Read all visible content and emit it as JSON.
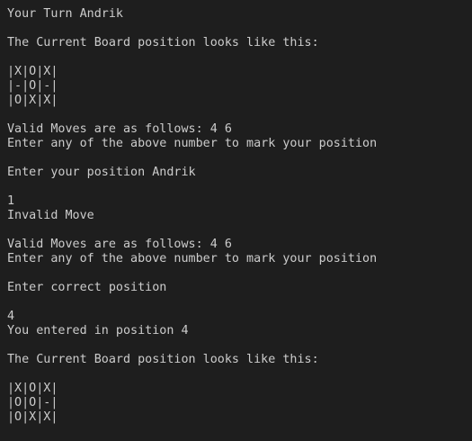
{
  "terminal": {
    "lines": [
      "Your Turn Andrik",
      "",
      "The Current Board position looks like this:",
      "",
      "|X|O|X|",
      "|-|O|-|",
      "|O|X|X|",
      "",
      "Valid Moves are as follows: 4 6",
      "Enter any of the above number to mark your position",
      "",
      "Enter your position Andrik",
      "",
      "1",
      "Invalid Move",
      "",
      "Valid Moves are as follows: 4 6",
      "Enter any of the above number to mark your position",
      "",
      "Enter correct position",
      "",
      "4",
      "You entered in position 4",
      "",
      "The Current Board position looks like this:",
      "",
      "|X|O|X|",
      "|O|O|-|",
      "|O|X|X|"
    ]
  }
}
